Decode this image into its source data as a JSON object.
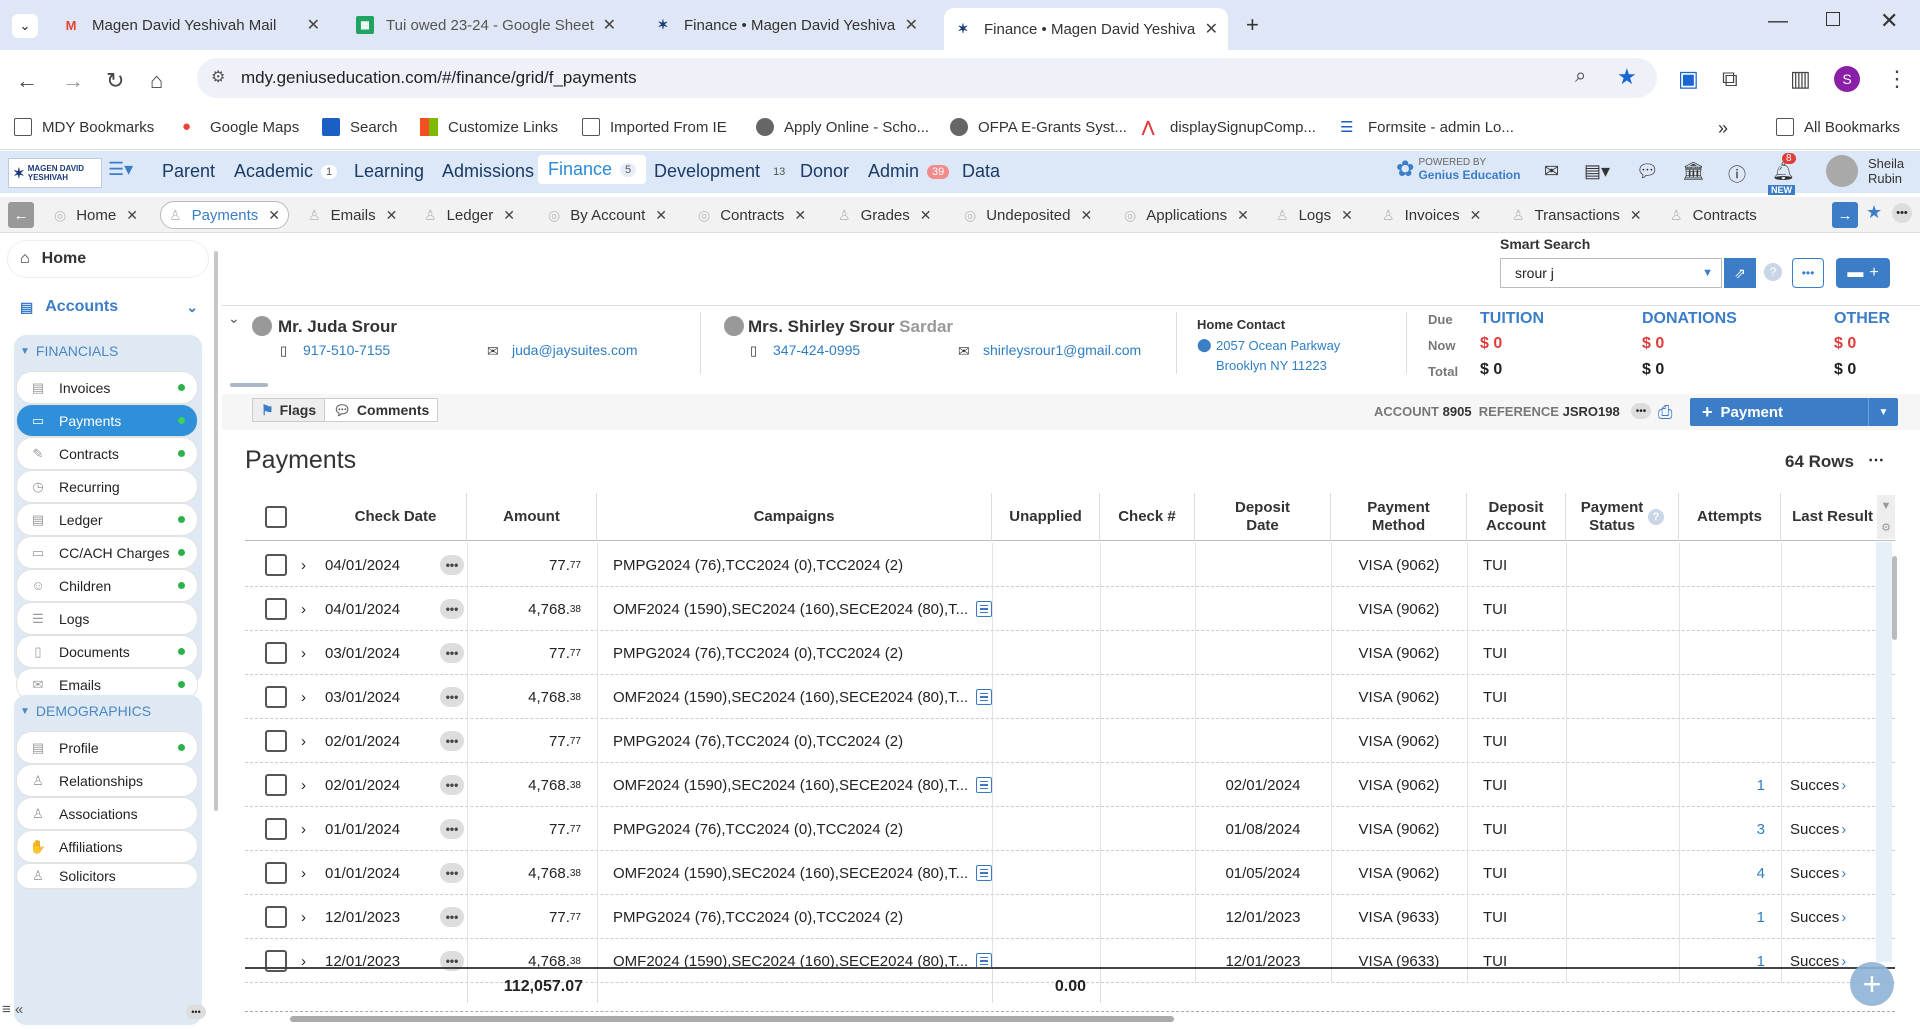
{
  "browser": {
    "tabs": [
      {
        "title": "Magen David Yeshivah Mail",
        "icon": "gmail-icon"
      },
      {
        "title": "Tui owed 23-24 - Google Sheet",
        "icon": "sheets-icon"
      },
      {
        "title": "Finance • Magen David Yeshiva",
        "icon": "mdy-icon"
      },
      {
        "title": "Finance • Magen David Yeshiva",
        "icon": "mdy-icon"
      }
    ],
    "url": "mdy.geniuseducation.com/#/finance/grid/f_payments",
    "profile_initial": "S",
    "bookmarks": [
      "MDY Bookmarks",
      "Google Maps",
      "Search",
      "Customize Links",
      "Imported From IE",
      "Apply Online - Scho...",
      "OFPA E-Grants Syst...",
      "displaySignupComp...",
      "Formsite - admin Lo..."
    ],
    "all_bookmarks": "All Bookmarks"
  },
  "app": {
    "logo_text": "MAGEN DAVID YESHIVAH",
    "nav": [
      {
        "label": "Parent",
        "count": ""
      },
      {
        "label": "Academic",
        "count": "1"
      },
      {
        "label": "Learning",
        "count": ""
      },
      {
        "label": "Admissions",
        "count": ""
      },
      {
        "label": "Finance",
        "count": "5"
      },
      {
        "label": "Development",
        "count": "13"
      },
      {
        "label": "Donor",
        "count": ""
      },
      {
        "label": "Admin",
        "count": "39"
      },
      {
        "label": "Data",
        "count": ""
      }
    ],
    "powered_by": "POWERED BY",
    "powered_name": "Genius Education",
    "notif_count": "8",
    "new_badge": "NEW",
    "user_first": "Sheila",
    "user_last": "Rubin"
  },
  "tabs": [
    "Home",
    "Payments",
    "Emails",
    "Ledger",
    "By Account",
    "Contracts",
    "Grades",
    "Undeposited",
    "Applications",
    "Logs",
    "Invoices",
    "Transactions",
    "Contracts"
  ],
  "sidebar": {
    "home": "Home",
    "accounts": "Accounts",
    "financials_header": "FINANCIALS",
    "financials": [
      "Invoices",
      "Payments",
      "Contracts",
      "Recurring",
      "Ledger",
      "CC/ACH Charges",
      "Children",
      "Logs",
      "Documents",
      "Emails"
    ],
    "demographics_header": "DEMOGRAPHICS",
    "demographics": [
      "Profile",
      "Relationships",
      "Associations",
      "Affiliations",
      "Solicitors"
    ]
  },
  "smart_search": {
    "label": "Smart Search",
    "value": "srour j"
  },
  "family": {
    "parent1": {
      "name": "Mr. Juda Srour",
      "phone": "917-510-7155",
      "email": "juda@jaysuites.com"
    },
    "parent2": {
      "name": "Mrs. Shirley Srour",
      "maiden": "Sardar",
      "phone": "347-424-0995",
      "email": "shirleysrour1@gmail.com"
    },
    "home_contact_label": "Home Contact",
    "address1": "2057 Ocean Parkway",
    "address2": "Brooklyn NY 11223"
  },
  "balances": {
    "row_labels": [
      "Due",
      "Now",
      "Total"
    ],
    "tuition": {
      "label": "TUITION",
      "now": "$ 0",
      "total": "$ 0"
    },
    "donations": {
      "label": "DONATIONS",
      "now": "$ 0",
      "total": "$ 0"
    },
    "other": {
      "label": "OTHER",
      "now": "$ 0",
      "total": "$ 0"
    }
  },
  "toolbar": {
    "flags": "Flags",
    "comments": "Comments",
    "account_label": "ACCOUNT",
    "account": "8905",
    "reference_label": "REFERENCE",
    "reference": "JSRO198",
    "payment_button": "Payment"
  },
  "payments": {
    "title": "Payments",
    "row_count": "64 Rows",
    "columns": [
      "Check Date",
      "Amount",
      "Campaigns",
      "Unapplied",
      "Check #",
      "Deposit Date",
      "Payment Method",
      "Deposit Account",
      "Payment Status",
      "Attempts",
      "Last Result"
    ],
    "rows": [
      {
        "check_date": "04/01/2024",
        "amount_main": "77.",
        "amount_cents": "77",
        "campaigns": "PMPG2024 (76),TCC2024 (0),TCC2024 (2)",
        "note": false,
        "deposit_date": "",
        "method": "VISA (9062)",
        "account": "TUI",
        "attempts": "",
        "last_result": ""
      },
      {
        "check_date": "04/01/2024",
        "amount_main": "4,768.",
        "amount_cents": "38",
        "campaigns": "OMF2024 (1590),SEC2024 (160),SECE2024 (80),T...",
        "note": true,
        "deposit_date": "",
        "method": "VISA (9062)",
        "account": "TUI",
        "attempts": "",
        "last_result": ""
      },
      {
        "check_date": "03/01/2024",
        "amount_main": "77.",
        "amount_cents": "77",
        "campaigns": "PMPG2024 (76),TCC2024 (0),TCC2024 (2)",
        "note": false,
        "deposit_date": "",
        "method": "VISA (9062)",
        "account": "TUI",
        "attempts": "",
        "last_result": ""
      },
      {
        "check_date": "03/01/2024",
        "amount_main": "4,768.",
        "amount_cents": "38",
        "campaigns": "OMF2024 (1590),SEC2024 (160),SECE2024 (80),T...",
        "note": true,
        "deposit_date": "",
        "method": "VISA (9062)",
        "account": "TUI",
        "attempts": "",
        "last_result": ""
      },
      {
        "check_date": "02/01/2024",
        "amount_main": "77.",
        "amount_cents": "77",
        "campaigns": "PMPG2024 (76),TCC2024 (0),TCC2024 (2)",
        "note": false,
        "deposit_date": "",
        "method": "VISA (9062)",
        "account": "TUI",
        "attempts": "",
        "last_result": ""
      },
      {
        "check_date": "02/01/2024",
        "amount_main": "4,768.",
        "amount_cents": "38",
        "campaigns": "OMF2024 (1590),SEC2024 (160),SECE2024 (80),T...",
        "note": true,
        "deposit_date": "02/01/2024",
        "method": "VISA (9062)",
        "account": "TUI",
        "attempts": "1",
        "last_result": "Succes"
      },
      {
        "check_date": "01/01/2024",
        "amount_main": "77.",
        "amount_cents": "77",
        "campaigns": "PMPG2024 (76),TCC2024 (0),TCC2024 (2)",
        "note": false,
        "deposit_date": "01/08/2024",
        "method": "VISA (9062)",
        "account": "TUI",
        "attempts": "3",
        "last_result": "Succes"
      },
      {
        "check_date": "01/01/2024",
        "amount_main": "4,768.",
        "amount_cents": "38",
        "campaigns": "OMF2024 (1590),SEC2024 (160),SECE2024 (80),T...",
        "note": true,
        "deposit_date": "01/05/2024",
        "method": "VISA (9062)",
        "account": "TUI",
        "attempts": "4",
        "last_result": "Succes"
      },
      {
        "check_date": "12/01/2023",
        "amount_main": "77.",
        "amount_cents": "77",
        "campaigns": "PMPG2024 (76),TCC2024 (0),TCC2024 (2)",
        "note": false,
        "deposit_date": "12/01/2023",
        "method": "VISA (9633)",
        "account": "TUI",
        "attempts": "1",
        "last_result": "Succes"
      },
      {
        "check_date": "12/01/2023",
        "amount_main": "4,768.",
        "amount_cents": "38",
        "campaigns": "OMF2024 (1590),SEC2024 (160),SECE2024 (80),T...",
        "note": true,
        "deposit_date": "12/01/2023",
        "method": "VISA (9633)",
        "account": "TUI",
        "attempts": "1",
        "last_result": "Succes"
      }
    ],
    "total_amount": "112,057.07",
    "total_unapplied": "0.00"
  }
}
